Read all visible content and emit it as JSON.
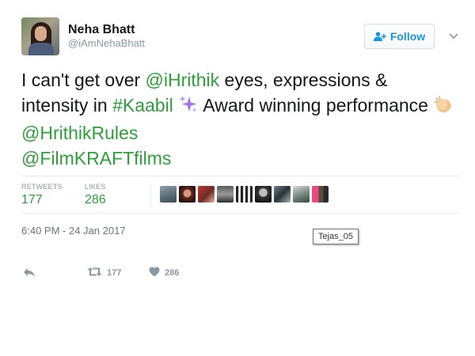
{
  "user": {
    "display_name": "Neha Bhatt",
    "handle": "@iAmNehaBhatt",
    "avatar_icon": "avatar"
  },
  "follow_button": {
    "label": "Follow",
    "icon": "add-user-icon",
    "color": "#1b95e0"
  },
  "menu_caret": {
    "icon": "chevron-down-icon"
  },
  "tweet": {
    "segments": [
      {
        "text": "I can't get over ",
        "type": "text"
      },
      {
        "text": "@iHrithik",
        "type": "link"
      },
      {
        "text": " eyes, expressions & intensity in ",
        "type": "text"
      },
      {
        "text": "#Kaabil",
        "type": "link"
      },
      {
        "text": " ",
        "type": "text"
      },
      {
        "text": "sparkles",
        "type": "emoji"
      },
      {
        "text": " Award winning performance ",
        "type": "text"
      },
      {
        "text": "clapping-hands",
        "type": "emoji"
      },
      {
        "text": " ",
        "type": "text"
      },
      {
        "text": "@HrithikRules",
        "type": "link"
      },
      {
        "text": " ",
        "type": "text"
      },
      {
        "text": "@FilmKRAFTfilms",
        "type": "link"
      }
    ],
    "link_color": "#2e9e3a"
  },
  "stats": {
    "retweets_label": "RETWEETS",
    "retweets_value": "177",
    "likes_label": "LIKES",
    "likes_value": "286",
    "liker_avatar_count": 9
  },
  "timestamp": "6:40 PM - 24 Jan 2017",
  "tooltip": "Tejas_05",
  "actions": {
    "reply_icon": "reply-icon",
    "retweet_icon": "retweet-icon",
    "retweet_count": "177",
    "like_icon": "heart-icon",
    "like_count": "286"
  }
}
